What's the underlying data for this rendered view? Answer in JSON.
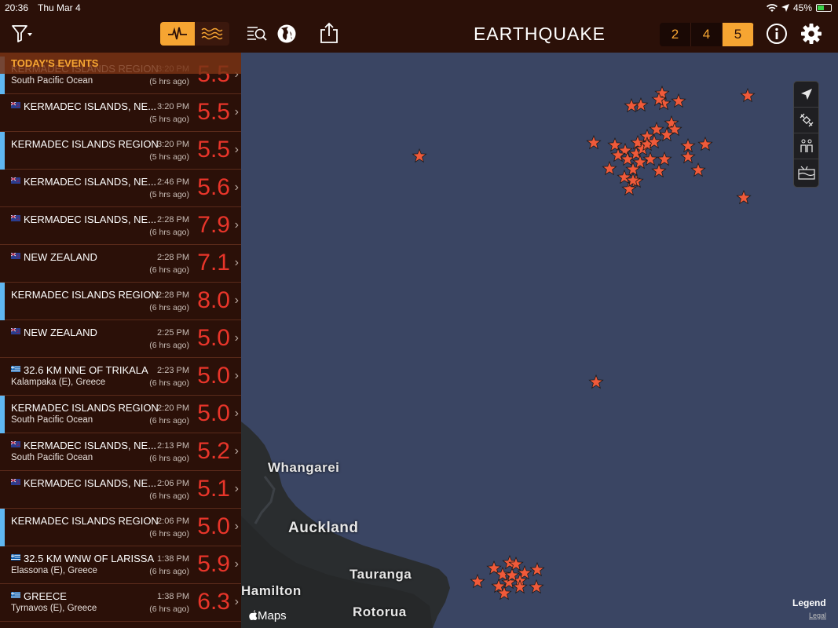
{
  "status_bar": {
    "time": "20:36",
    "date": "Thu Mar 4",
    "battery": "45%",
    "battery_level": 0.45
  },
  "header": {
    "title": "EARTHQUAKE",
    "magnitude_filter": [
      "2",
      "4",
      "5"
    ],
    "selected_magnitude": "5"
  },
  "sidebar": {
    "header": "TODAY'S EVENTS",
    "events": [
      {
        "title": "KERMADEC ISLANDS REGION",
        "subtitle": "South Pacific Ocean",
        "time": "3:20 PM",
        "ago": "(5 hrs ago)",
        "magnitude": "5.5",
        "flag": ""
      },
      {
        "title": "KERMADEC ISLANDS, NE...",
        "subtitle": "",
        "time": "3:20 PM",
        "ago": "(5 hrs ago)",
        "magnitude": "5.5",
        "flag": "nz"
      },
      {
        "title": "KERMADEC ISLANDS REGION",
        "subtitle": "",
        "time": "3:20 PM",
        "ago": "(5 hrs ago)",
        "magnitude": "5.5",
        "flag": ""
      },
      {
        "title": "KERMADEC ISLANDS, NE...",
        "subtitle": "",
        "time": "2:46 PM",
        "ago": "(5 hrs ago)",
        "magnitude": "5.6",
        "flag": "nz"
      },
      {
        "title": "KERMADEC ISLANDS, NE...",
        "subtitle": "",
        "time": "2:28 PM",
        "ago": "(6 hrs ago)",
        "magnitude": "7.9",
        "flag": "nz"
      },
      {
        "title": "NEW ZEALAND",
        "subtitle": "",
        "time": "2:28 PM",
        "ago": "(6 hrs ago)",
        "magnitude": "7.1",
        "flag": "nz"
      },
      {
        "title": "KERMADEC ISLANDS REGION",
        "subtitle": "",
        "time": "2:28 PM",
        "ago": "(6 hrs ago)",
        "magnitude": "8.0",
        "flag": ""
      },
      {
        "title": "NEW ZEALAND",
        "subtitle": "",
        "time": "2:25 PM",
        "ago": "(6 hrs ago)",
        "magnitude": "5.0",
        "flag": "nz"
      },
      {
        "title": "32.6 KM NNE OF TRIKALA",
        "subtitle": "Kalampaka (E), Greece",
        "time": "2:23 PM",
        "ago": "(6 hrs ago)",
        "magnitude": "5.0",
        "flag": "gr"
      },
      {
        "title": "KERMADEC ISLANDS REGION",
        "subtitle": "South Pacific Ocean",
        "time": "2:20 PM",
        "ago": "(6 hrs ago)",
        "magnitude": "5.0",
        "flag": ""
      },
      {
        "title": "KERMADEC ISLANDS, NE...",
        "subtitle": "South Pacific Ocean",
        "time": "2:13 PM",
        "ago": "(6 hrs ago)",
        "magnitude": "5.2",
        "flag": "nz"
      },
      {
        "title": "KERMADEC ISLANDS, NE...",
        "subtitle": "",
        "time": "2:06 PM",
        "ago": "(6 hrs ago)",
        "magnitude": "5.1",
        "flag": "nz"
      },
      {
        "title": "KERMADEC ISLANDS REGION",
        "subtitle": "",
        "time": "2:06 PM",
        "ago": "(6 hrs ago)",
        "magnitude": "5.0",
        "flag": ""
      },
      {
        "title": "32.5 KM WNW OF LARISSA",
        "subtitle": "Elassona (E), Greece",
        "time": "1:38 PM",
        "ago": "(6 hrs ago)",
        "magnitude": "5.9",
        "flag": "gr"
      },
      {
        "title": "GREECE",
        "subtitle": "Tyrnavos (E), Greece",
        "time": "1:38 PM",
        "ago": "(6 hrs ago)",
        "magnitude": "6.3",
        "flag": "gr"
      }
    ]
  },
  "map": {
    "cities": [
      "Whangarei",
      "Auckland",
      "Tauranga",
      "Hamilton",
      "Rotorua"
    ],
    "attribution": "Maps",
    "legend": "Legend",
    "legal": "Legal"
  },
  "colors": {
    "accent": "#f6a532",
    "magnitude": "#e8352a",
    "marker": "#f05a3a",
    "bar": "#2b1008",
    "row_accent": "#5fb7f2"
  }
}
